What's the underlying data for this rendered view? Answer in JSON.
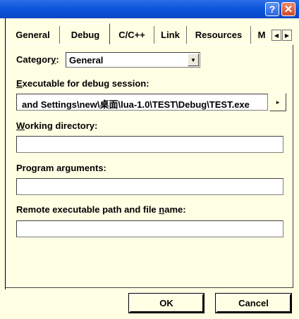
{
  "titlebar": {
    "help_icon": "?",
    "close_icon": "✕",
    "accent": "#0a52d8"
  },
  "tabs": [
    {
      "label": "General"
    },
    {
      "label": "Debug"
    },
    {
      "label": "C/C++"
    },
    {
      "label": "Link"
    },
    {
      "label": "Resources"
    },
    {
      "label": "M"
    }
  ],
  "tab_scroll": {
    "left_icon": "◀",
    "right_icon": "▶"
  },
  "category": {
    "label_pre": "Categor",
    "label_u": "y",
    "label_post": ":",
    "value": "General"
  },
  "executable": {
    "label_u": "E",
    "label_rest": "xecutable for debug session:",
    "value": "and Settings\\new\\桌面\\lua-1.0\\TEST\\Debug\\TEST.exe",
    "more_icon": "▸"
  },
  "working_dir": {
    "label_u": "W",
    "label_rest": "orking directory:",
    "value": ""
  },
  "program_args": {
    "label_pre": "Program ar",
    "label_u": "g",
    "label_post": "uments:",
    "value": ""
  },
  "remote_path": {
    "label_pre": "Remote executable path and file ",
    "label_u": "n",
    "label_post": "ame:",
    "value": ""
  },
  "buttons": {
    "ok": "OK",
    "cancel": "Cancel"
  }
}
